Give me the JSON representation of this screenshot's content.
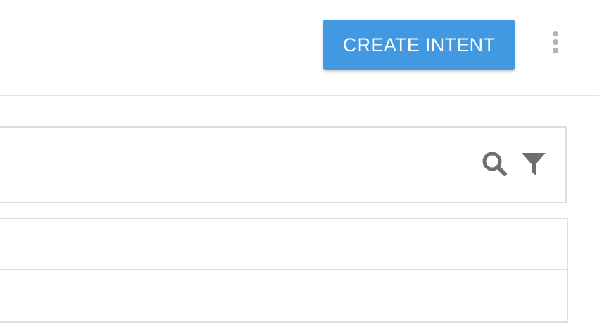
{
  "toolbar": {
    "create_label": "CREATE INTENT",
    "more_icon": "more-vertical-icon"
  },
  "search": {
    "value": "",
    "placeholder": "",
    "search_icon": "search-icon",
    "filter_icon": "filter-icon"
  },
  "intents": {
    "items": [
      {
        "name": ""
      },
      {
        "name": ""
      }
    ]
  },
  "colors": {
    "primary_button": "#4399e1",
    "icon": "#6f6f6f",
    "border": "#dedede",
    "more_dots": "#b4b4b4"
  }
}
